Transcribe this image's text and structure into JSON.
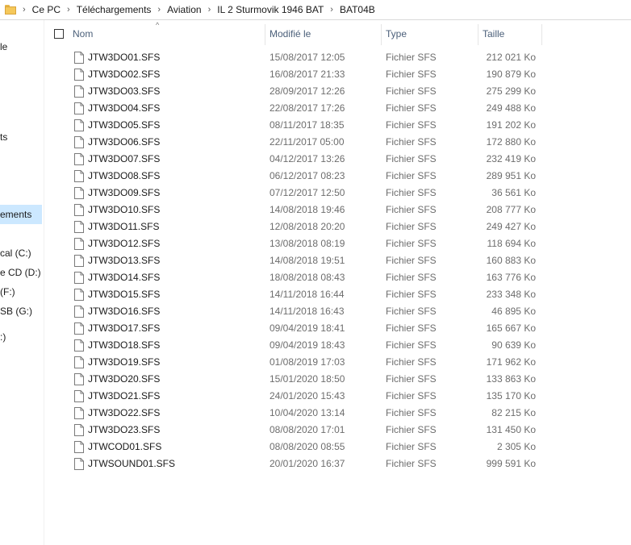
{
  "breadcrumb": [
    "Ce PC",
    "Téléchargements",
    "Aviation",
    "IL 2 Sturmovik 1946 BAT",
    "BAT04B"
  ],
  "nav": {
    "items": [
      {
        "label": "le"
      },
      {
        "label": "ts"
      },
      {
        "label": "ements"
      },
      {
        "label": "cal (C:)"
      },
      {
        "label": "e CD (D:)"
      },
      {
        "label": "(F:)"
      },
      {
        "label": "SB (G:)"
      },
      {
        "label": ":)"
      }
    ]
  },
  "columns": {
    "name": "Nom",
    "modified": "Modifié le",
    "type": "Type",
    "size": "Taille",
    "sort_arrow": "^"
  },
  "files": [
    {
      "name": "JTW3DO01.SFS",
      "modified": "15/08/2017 12:05",
      "type": "Fichier SFS",
      "size": "212 021 Ko"
    },
    {
      "name": "JTW3DO02.SFS",
      "modified": "16/08/2017 21:33",
      "type": "Fichier SFS",
      "size": "190 879 Ko"
    },
    {
      "name": "JTW3DO03.SFS",
      "modified": "28/09/2017 12:26",
      "type": "Fichier SFS",
      "size": "275 299 Ko"
    },
    {
      "name": "JTW3DO04.SFS",
      "modified": "22/08/2017 17:26",
      "type": "Fichier SFS",
      "size": "249 488 Ko"
    },
    {
      "name": "JTW3DO05.SFS",
      "modified": "08/11/2017 18:35",
      "type": "Fichier SFS",
      "size": "191 202 Ko"
    },
    {
      "name": "JTW3DO06.SFS",
      "modified": "22/11/2017 05:00",
      "type": "Fichier SFS",
      "size": "172 880 Ko"
    },
    {
      "name": "JTW3DO07.SFS",
      "modified": "04/12/2017 13:26",
      "type": "Fichier SFS",
      "size": "232 419 Ko"
    },
    {
      "name": "JTW3DO08.SFS",
      "modified": "06/12/2017 08:23",
      "type": "Fichier SFS",
      "size": "289 951 Ko"
    },
    {
      "name": "JTW3DO09.SFS",
      "modified": "07/12/2017 12:50",
      "type": "Fichier SFS",
      "size": "36 561 Ko"
    },
    {
      "name": "JTW3DO10.SFS",
      "modified": "14/08/2018 19:46",
      "type": "Fichier SFS",
      "size": "208 777 Ko"
    },
    {
      "name": "JTW3DO11.SFS",
      "modified": "12/08/2018 20:20",
      "type": "Fichier SFS",
      "size": "249 427 Ko"
    },
    {
      "name": "JTW3DO12.SFS",
      "modified": "13/08/2018 08:19",
      "type": "Fichier SFS",
      "size": "118 694 Ko"
    },
    {
      "name": "JTW3DO13.SFS",
      "modified": "14/08/2018 19:51",
      "type": "Fichier SFS",
      "size": "160 883 Ko"
    },
    {
      "name": "JTW3DO14.SFS",
      "modified": "18/08/2018 08:43",
      "type": "Fichier SFS",
      "size": "163 776 Ko"
    },
    {
      "name": "JTW3DO15.SFS",
      "modified": "14/11/2018 16:44",
      "type": "Fichier SFS",
      "size": "233 348 Ko"
    },
    {
      "name": "JTW3DO16.SFS",
      "modified": "14/11/2018 16:43",
      "type": "Fichier SFS",
      "size": "46 895 Ko"
    },
    {
      "name": "JTW3DO17.SFS",
      "modified": "09/04/2019 18:41",
      "type": "Fichier SFS",
      "size": "165 667 Ko"
    },
    {
      "name": "JTW3DO18.SFS",
      "modified": "09/04/2019 18:43",
      "type": "Fichier SFS",
      "size": "90 639 Ko"
    },
    {
      "name": "JTW3DO19.SFS",
      "modified": "01/08/2019 17:03",
      "type": "Fichier SFS",
      "size": "171 962 Ko"
    },
    {
      "name": "JTW3DO20.SFS",
      "modified": "15/01/2020 18:50",
      "type": "Fichier SFS",
      "size": "133 863 Ko"
    },
    {
      "name": "JTW3DO21.SFS",
      "modified": "24/01/2020 15:43",
      "type": "Fichier SFS",
      "size": "135 170 Ko"
    },
    {
      "name": "JTW3DO22.SFS",
      "modified": "10/04/2020 13:14",
      "type": "Fichier SFS",
      "size": "82 215 Ko"
    },
    {
      "name": "JTW3DO23.SFS",
      "modified": "08/08/2020 17:01",
      "type": "Fichier SFS",
      "size": "131 450 Ko"
    },
    {
      "name": "JTWCOD01.SFS",
      "modified": "08/08/2020 08:55",
      "type": "Fichier SFS",
      "size": "2 305 Ko"
    },
    {
      "name": "JTWSOUND01.SFS",
      "modified": "20/01/2020 16:37",
      "type": "Fichier SFS",
      "size": "999 591 Ko"
    }
  ],
  "icons": {
    "address_folder": "folder-icon",
    "file": "file-icon",
    "breadcrumb_separator": "chevron-right-icon"
  },
  "colors": {
    "selected_nav": "#cce8ff",
    "header_text": "#4c607a",
    "folder": "#f5c85a"
  }
}
